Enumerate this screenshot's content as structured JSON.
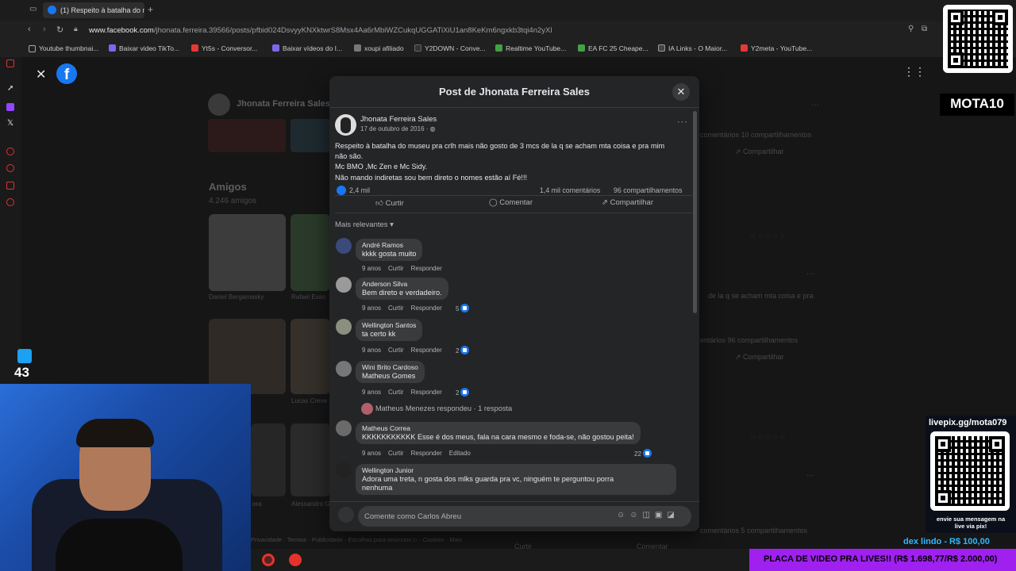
{
  "browser": {
    "tab_title": "(1) Respeito à batalha do m",
    "url_host": "www.facebook.com",
    "url_path": "/jhonata.ferreira.39566/posts/pfbid024DsvyyKNXktwrS8Msx4Aa6rMbiWZCukqUGGATiXiU1an8KeKm6ngxkb3tqi4n2yXl",
    "bookmarks": [
      "Youtube thumbnai...",
      "Baixar video TikTo...",
      "Yt5s - Conversor...",
      "Baixar vídeos do I...",
      "xoupi afiliado",
      "Y2DOWN - Conve...",
      "Realtime YouTube...",
      "EA FC 25 Cheape...",
      "IA Links - O Maior...",
      "Y2meta - YouTube..."
    ],
    "bookmark_colors": [
      "#333333",
      "#7b68ee",
      "#e53935",
      "#7b68ee",
      "#888888",
      "#333333",
      "#43a047",
      "#43a047",
      "#444444",
      "#e53935"
    ]
  },
  "background_page": {
    "profile_name": "Jhonata Ferreira Sales",
    "friends_title": "Amigos",
    "friends_count": "4.246 amigos",
    "friend_names": [
      "Daniel Bergamasky",
      "Rafael Evan",
      "Lucas Creve",
      "ora",
      "Alessandro G"
    ],
    "right_stats_1": "comentários   10 compartilhamentos",
    "share_label": "Compartilhar",
    "right_text": "de la q se acham mta coisa e pra",
    "right_stats_2": "entários   96 compartilhamentos",
    "right_stats_3": "comentários   5 compartilhamentos",
    "footer": "Privacidade · Termos · Publicidade · Escolhas para anúncios ▷ · Cookies · Mais",
    "curtir": "Curtir",
    "comentar": "Comentar"
  },
  "modal": {
    "title": "Post de Jhonata Ferreira Sales",
    "author": "Jhonata Ferreira Sales",
    "date": "17 de outubro de 2016 · ",
    "post_lines": [
      "Respeito à batalha do museu pra crlh mais não gosto de 3 mcs de la q se acham mta coisa e pra mim",
      "não são.",
      "Mc BMO ,Mc Zen e Mc Sidy.",
      "Não mando indiretas sou bem direto o nomes estão aí Fé!!!"
    ],
    "reactions": "2,4 mil",
    "comments_count": "1,4 mil comentários",
    "shares_count": "96 compartilhamentos",
    "like_label": "Curtir",
    "comment_label": "Comentar",
    "share_label": "Compartilhar",
    "sort_label": "Mais relevantes",
    "comments": [
      {
        "name": "André Ramos",
        "text": "kkkk gosta muito",
        "age": "9 anos",
        "like": "Curtir",
        "reply": "Responder",
        "likes": ""
      },
      {
        "name": "Anderson Silva",
        "text": "Bem direto e verdadeiro.",
        "age": "9 anos",
        "like": "Curtir",
        "reply": "Responder",
        "likes": "5"
      },
      {
        "name": "Wellington Santos",
        "text": "ta certo kk",
        "age": "9 anos",
        "like": "Curtir",
        "reply": "Responder",
        "likes": "2"
      },
      {
        "name": "Wini Brito Cardoso",
        "text": "Matheus Gomes",
        "age": "9 anos",
        "like": "Curtir",
        "reply": "Responder",
        "likes": "2"
      },
      {
        "name": "Matheus Correa",
        "text": "KKKKKKKKKKK Esse é dos meus, fala na cara mesmo e foda-se, não gostou peita!",
        "age": "9 anos",
        "like": "Curtir",
        "reply": "Responder",
        "edited": "Editado",
        "likes": "22"
      },
      {
        "name": "Wellington Junior",
        "text": "Adora uma treta, n gosta dos mlks guarda pra vc, ninguém te perguntou porra",
        "text2": "nenhuma"
      }
    ],
    "reply_summary": "Matheus Menezes respondeu · 1 resposta",
    "compose_placeholder": "Comente como Carlos Abreu"
  },
  "overlay": {
    "channel_name": "MOTA10",
    "live_like_count": "43",
    "livepix_url": "livepix.gg/mota079",
    "livepix_caption_1": "envie sua mensagem na",
    "livepix_caption_2": "live via pix!",
    "donation": "dex lindo - R$ 100,00",
    "goal": "PLACA DE VIDEO PRA LIVES!! (R$ 1.698,77/R$ 2.000,00)"
  }
}
